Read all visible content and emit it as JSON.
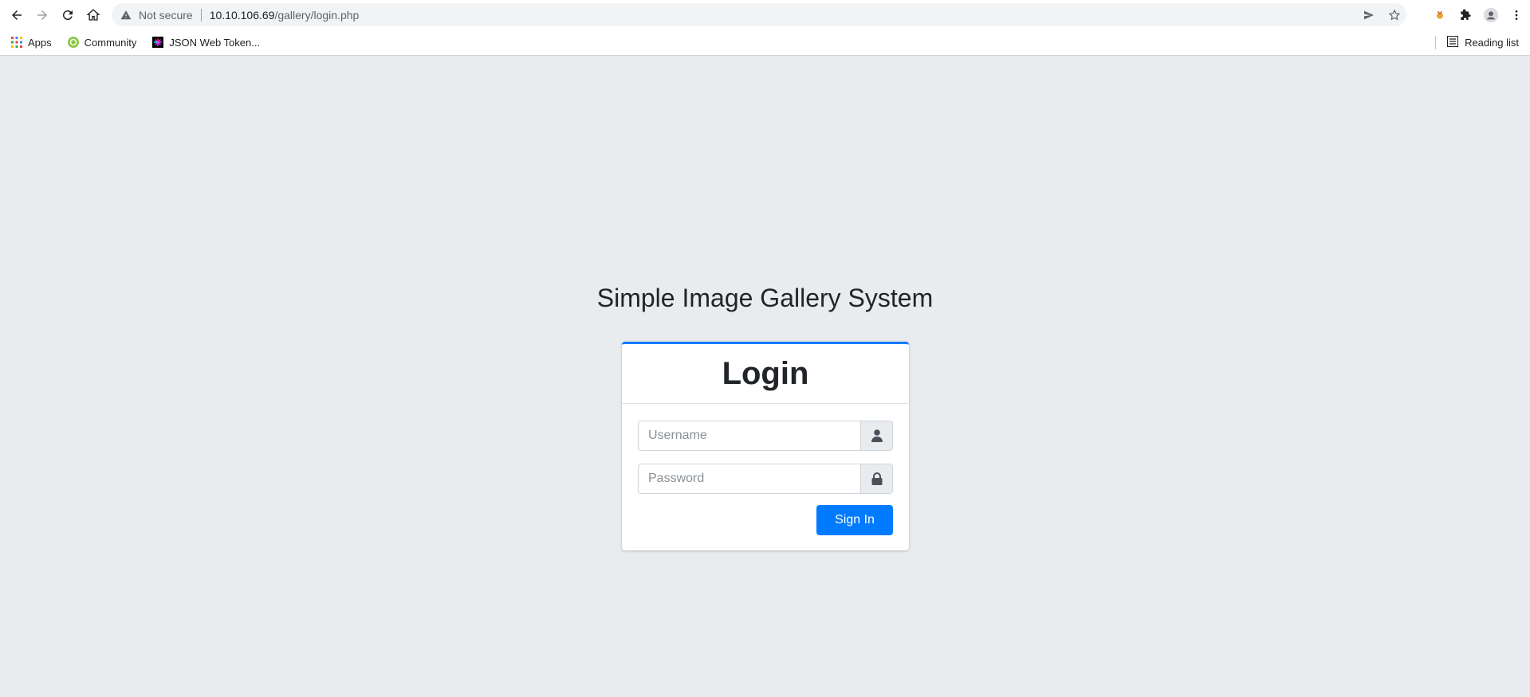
{
  "browser": {
    "security_label": "Not secure",
    "url_host": "10.10.106.69",
    "url_path": "/gallery/login.php"
  },
  "bookmarks": {
    "items": [
      {
        "label": "Apps",
        "icon": "apps-grid-icon"
      },
      {
        "label": "Community",
        "icon": "community-icon"
      },
      {
        "label": "JSON Web Token...",
        "icon": "jwt-icon"
      }
    ],
    "reading_list_label": "Reading list"
  },
  "page": {
    "title": "Simple Image Gallery System"
  },
  "login_card": {
    "heading": "Login",
    "username_placeholder": "Username",
    "password_placeholder": "Password",
    "signin_label": "Sign In",
    "accent_color": "#007bff"
  }
}
